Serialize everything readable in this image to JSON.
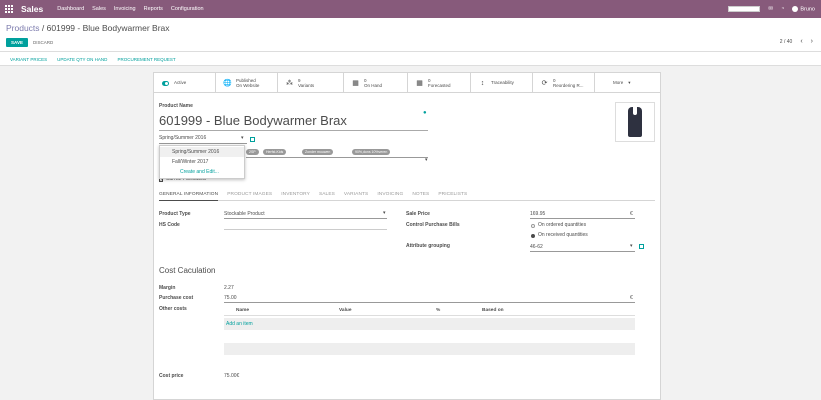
{
  "topbar": {
    "app_name": "Sales",
    "menu": [
      "Dashboard",
      "Sales",
      "Invoicing",
      "Reports",
      "Configuration"
    ],
    "user": "Bruno"
  },
  "breadcrumb": {
    "parent": "Products",
    "separator": "/",
    "current": "601999 - Blue Bodywarmer Brax"
  },
  "buttons": {
    "save": "SAVE",
    "discard": "DISCARD"
  },
  "pager": {
    "value": "2 / 40",
    "prev": "‹",
    "next": "›"
  },
  "actions": [
    "VARIANT PRICES",
    "UPDATE QTY ON HAND",
    "PROCUREMENT REQUEST"
  ],
  "stat_buttons": {
    "active": "Active",
    "published_1": "Published",
    "published_2": "On Website",
    "variants_n": "9",
    "variants": "Variants",
    "onhand_n": "0",
    "onhand": "On Hand",
    "forecast_n": "0",
    "forecast": "Forecasted",
    "traceability": "Traceability",
    "reorder_n": "0",
    "reorder": "Reordering R...",
    "more": "More"
  },
  "form": {
    "product_name_label": "Product Name",
    "product_name": "601999 - Blue Bodywarmer Brax",
    "season_value": "Spring/Summer 2016",
    "dropdown_items": [
      "Spring/Summer 2016",
      "Fall/Winter 2017"
    ],
    "dropdown_create": "Create and Edit...",
    "tags": [
      "2SP",
      "Herfst-Kids",
      "Zonder mouwen",
      "90%,dons 10%veren"
    ],
    "can_be_purchased": "Can be Purchased"
  },
  "tabs": [
    "GENERAL INFORMATION",
    "PRODUCT IMAGES",
    "INVENTORY",
    "SALES",
    "VARIANTS",
    "INVOICING",
    "NOTES",
    "PRICELISTS"
  ],
  "general": {
    "product_type_label": "Product Type",
    "product_type": "Stockable Product",
    "hs_code_label": "HS Code",
    "sale_price_label": "Sale Price",
    "sale_price": "169.95",
    "currency": "€",
    "control_label": "Control Purchase Bills",
    "control_opt1": "On ordered quantities",
    "control_opt2": "On received quantities",
    "attr_group_label": "Attribute grouping",
    "attr_group": "46-62"
  },
  "cost": {
    "title": "Cost Caculation",
    "margin_label": "Margin",
    "margin": "2.27",
    "purchase_label": "Purchase cost",
    "purchase": "75.00",
    "currency": "€",
    "other_label": "Other costs",
    "columns": [
      "Name",
      "Value",
      "%",
      "Based on"
    ],
    "add_line": "Add an item",
    "cost_price_label": "Cost price",
    "cost_price": "75.00€"
  }
}
